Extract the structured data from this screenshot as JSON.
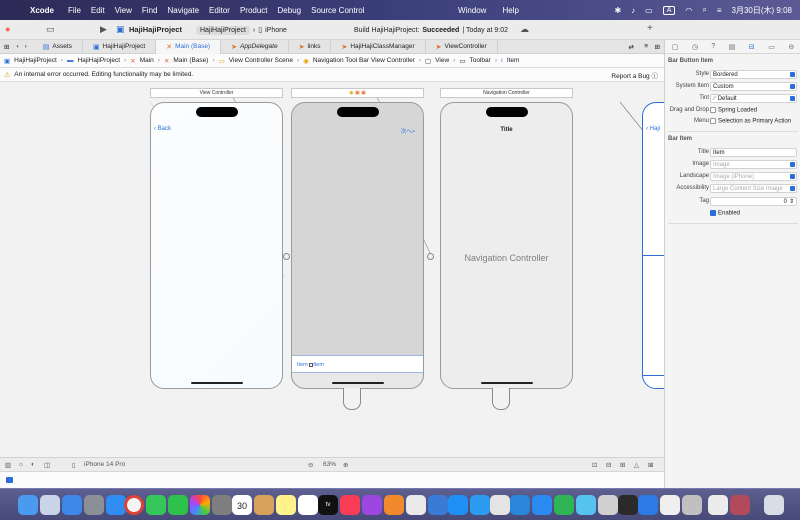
{
  "menubar": {
    "app": "Xcode",
    "items": [
      "File",
      "Edit",
      "View",
      "Find",
      "Navigate",
      "Editor",
      "Product",
      "Debug",
      "Source Control"
    ],
    "right_items": [
      "Window",
      "Help"
    ],
    "input_indicator": "A",
    "clock": "3月30日(木) 9:08"
  },
  "toolbar": {
    "project_name": "HajiHajiProject",
    "scheme": "HajiHajiProject",
    "destination": "iPhone",
    "status_prefix": "Build HajiHajiProject:",
    "status_result": "Succeeded",
    "status_time": "| Today at 9:02"
  },
  "tabs": [
    {
      "label": "Assets"
    },
    {
      "label": "HajiHajiProject"
    },
    {
      "label": "Main (Base)"
    },
    {
      "label": "AppDelegate"
    },
    {
      "label": "links"
    },
    {
      "label": "HajiHajiClassManager"
    },
    {
      "label": "ViewController"
    }
  ],
  "jumpbar": [
    "HajiHajiProject",
    "HajiHajiProject",
    "Main",
    "Main (Base)",
    "View Controller Scene",
    "Navigation Tool Bar View Controller",
    "View",
    "Toolbar",
    "Item"
  ],
  "error": {
    "message": "An internal error occurred. Editing functionality may be limited.",
    "action": "Report a Bug"
  },
  "canvas": {
    "scene1_title": "View Controller",
    "scene3_title": "Navigation Controller",
    "back_label": "Back",
    "toolbar_item_1": "Item",
    "toolbar_item_2": "Item",
    "top_right_label": "次へ>",
    "nav_title": "Title",
    "nav_center_label": "Navigation Controller",
    "partial_label": "Haji"
  },
  "bottombar": {
    "device": "iPhone 14 Pro",
    "zoom": "63%"
  },
  "inspector": {
    "section1": "Bar Button Item",
    "style_label": "Style",
    "style_value": "Bordered",
    "system_item_label": "System Item",
    "system_item_value": "Custom",
    "tint_label": "Tint",
    "tint_value": "Default",
    "drag_label": "Drag and Drop",
    "drag_value": "Spring Loaded",
    "menu_label": "Menu",
    "menu_value": "Selection as Primary Action",
    "section2": "Bar Item",
    "title_label": "Title",
    "title_value": "Item",
    "image_label": "Image",
    "image_placeholder": "Image",
    "landscape_label": "Landscape",
    "landscape_placeholder": "Image (iPhone)",
    "accessibility_label": "Accessibility",
    "accessibility_placeholder": "Large Content Size Image",
    "tag_label": "Tag",
    "tag_value": "0",
    "enabled_label": "Enabled"
  },
  "dock": {
    "calendar_day": "30",
    "tv_label": "tv"
  }
}
